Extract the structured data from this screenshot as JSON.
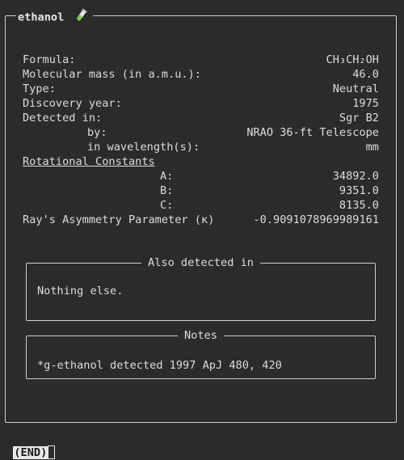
{
  "molecule": {
    "name": "ethanol",
    "icon": "test-tube-icon"
  },
  "fields": [
    {
      "label": "Formula:",
      "value": "CH₃CH₂OH"
    },
    {
      "label": "Molecular mass (in a.m.u.):",
      "value": "46.0"
    },
    {
      "label": "Type:",
      "value": "Neutral"
    },
    {
      "label": "Discovery year:",
      "value": "1975"
    },
    {
      "label": "Detected in:",
      "value": "Sgr B2"
    },
    {
      "label": "by:",
      "value": "NRAO 36-ft Telescope"
    },
    {
      "label": "in wavelength(s):",
      "value": "mm"
    }
  ],
  "rotational": {
    "heading": "Rotational Constants",
    "a_label": "A:",
    "a_value": "34892.0",
    "b_label": "B:",
    "b_value": "9351.0",
    "c_label": "C:",
    "c_value": "8135.0"
  },
  "asymmetry": {
    "label": "Ray's Asymmetry Parameter (κ)",
    "value": "-0.9091078969989161"
  },
  "also_detected": {
    "title": "Also detected in",
    "text": "Nothing else."
  },
  "notes": {
    "title": "Notes",
    "text": "*g-ethanol detected 1997 ApJ 480, 420"
  },
  "status": {
    "label": "(END)"
  },
  "colors": {
    "background": "#2b2b2b",
    "text": "#dcdcdc",
    "border": "#cfcfcf"
  }
}
